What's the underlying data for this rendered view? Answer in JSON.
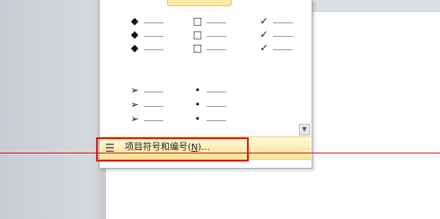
{
  "bullet_library": {
    "rows": [
      {
        "symbols": [
          "◆",
          "□",
          "✓"
        ]
      },
      {
        "symbols": [
          "◆",
          "□",
          "✓"
        ]
      },
      {
        "symbols": [
          "◆",
          "□",
          "✓"
        ]
      },
      {
        "symbols": [
          "➢",
          "•"
        ]
      },
      {
        "symbols": [
          "➢",
          "•"
        ]
      },
      {
        "symbols": [
          "➢",
          "•"
        ]
      }
    ]
  },
  "menu": {
    "define_bullets_prefix": "项目符号和编号(",
    "define_bullets_hotkey": "N",
    "define_bullets_suffix": ")...",
    "icon": "bulleted-list-icon"
  },
  "scroll_icon": "scroll-down-icon"
}
